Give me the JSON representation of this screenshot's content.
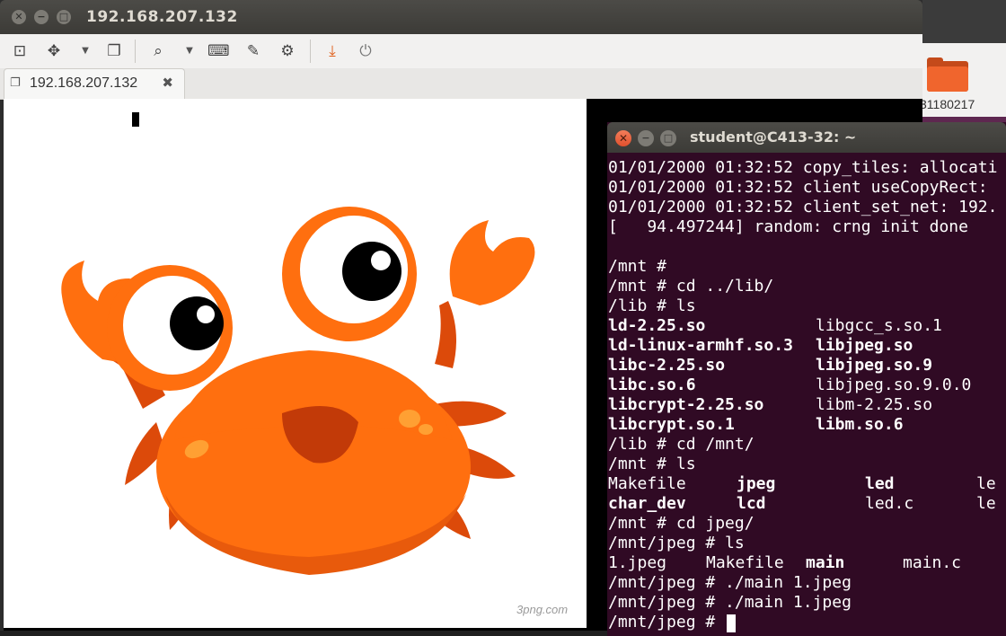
{
  "viewer": {
    "window_title": "192.168.207.132",
    "close_glyph": "✕",
    "min_glyph": "−",
    "max_glyph": "□",
    "tab_label": "192.168.207.132",
    "tab_close_glyph": "✖",
    "toolbar": {
      "icons": [
        "fullscreen-icon",
        "fit-window-icon",
        "monitor-icon",
        "zoom-icon",
        "keyboard-icon",
        "preferences-icon",
        "settings-icon",
        "download-icon",
        "disconnect-icon"
      ]
    },
    "remote_image_watermark": "3png.com"
  },
  "desktop": {
    "folder_label": "31180217"
  },
  "terminal": {
    "title": "student@C413-32: ~",
    "close_glyph": "✕",
    "min_glyph": "−",
    "max_glyph": "□",
    "lines": [
      {
        "cols": [
          "01/01/2000 01:32:52 copy_tiles: allocati"
        ]
      },
      {
        "cols": [
          "01/01/2000 01:32:52 client useCopyRect: "
        ]
      },
      {
        "cols": [
          "01/01/2000 01:32:52 client_set_net: 192."
        ]
      },
      {
        "cols": [
          "[   94.497244] random: crng init done"
        ]
      },
      {
        "cols": [
          ""
        ]
      },
      {
        "cols": [
          "/mnt #"
        ]
      },
      {
        "cols": [
          "/mnt # cd ../lib/"
        ]
      },
      {
        "cols": [
          "/lib # ls"
        ]
      },
      {
        "cols": [
          "ld-2.25.so",
          "libgcc_s.so.1"
        ],
        "bold": [
          true,
          false
        ]
      },
      {
        "cols": [
          "ld-linux-armhf.so.3",
          "libjpeg.so"
        ],
        "bold": [
          true,
          true
        ]
      },
      {
        "cols": [
          "libc-2.25.so",
          "libjpeg.so.9"
        ],
        "bold": [
          true,
          true
        ]
      },
      {
        "cols": [
          "libc.so.6",
          "libjpeg.so.9.0.0"
        ],
        "bold": [
          true,
          false
        ]
      },
      {
        "cols": [
          "libcrypt-2.25.so",
          "libm-2.25.so"
        ],
        "bold": [
          true,
          false
        ]
      },
      {
        "cols": [
          "libcrypt.so.1",
          "libm.so.6"
        ],
        "bold": [
          true,
          true
        ]
      },
      {
        "cols": [
          "/lib # cd /mnt/"
        ]
      },
      {
        "cols": [
          "/mnt # ls"
        ]
      },
      {
        "cols": [
          "Makefile",
          "jpeg",
          "led",
          "le"
        ],
        "bold": [
          false,
          true,
          true,
          false
        ]
      },
      {
        "cols": [
          "char_dev",
          "lcd",
          "led.c",
          "le"
        ],
        "bold": [
          true,
          true,
          false,
          false
        ]
      },
      {
        "cols": [
          "/mnt # cd jpeg/"
        ]
      },
      {
        "cols": [
          "/mnt/jpeg # ls"
        ]
      },
      {
        "cols": [
          "1.jpeg",
          "Makefile",
          "main",
          "main.c"
        ],
        "bold": [
          false,
          false,
          true,
          false
        ]
      },
      {
        "cols": [
          "/mnt/jpeg # ./main 1.jpeg"
        ]
      },
      {
        "cols": [
          "/mnt/jpeg # ./main 1.jpeg"
        ]
      },
      {
        "cols": [
          "/mnt/jpeg # "
        ],
        "cursor": true
      }
    ]
  },
  "colors": {
    "terminal_bg": "#300a24",
    "crab_orange": "#ff6f0f",
    "crab_dark": "#dc4a0a"
  }
}
